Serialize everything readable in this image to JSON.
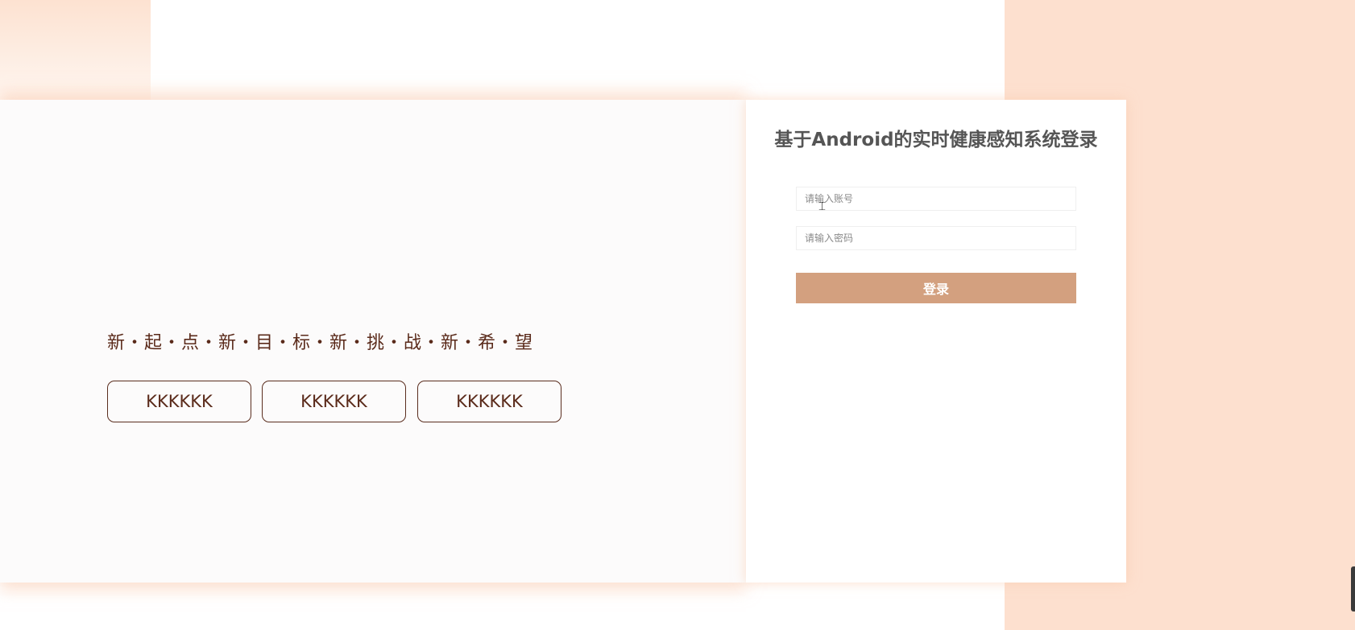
{
  "hero": {
    "slogan": "新・起・点・新・目・标・新・挑・战・新・希・望",
    "buttons": [
      "KKKKKK",
      "KKKKKK",
      "KKKKKK"
    ]
  },
  "login": {
    "title": "基于Android的实时健康感知系统登录",
    "account_placeholder": "请输入账号",
    "password_placeholder": "请输入密码",
    "submit_label": "登录"
  },
  "colors": {
    "page_background": "#ffffff",
    "peach_background": "#fde0cf",
    "login_button": "#d3a07f",
    "slogan_text": "#5a2a1a",
    "title_text": "#555555"
  },
  "icons": {
    "text_cursor": "i-beam-cursor-icon"
  }
}
